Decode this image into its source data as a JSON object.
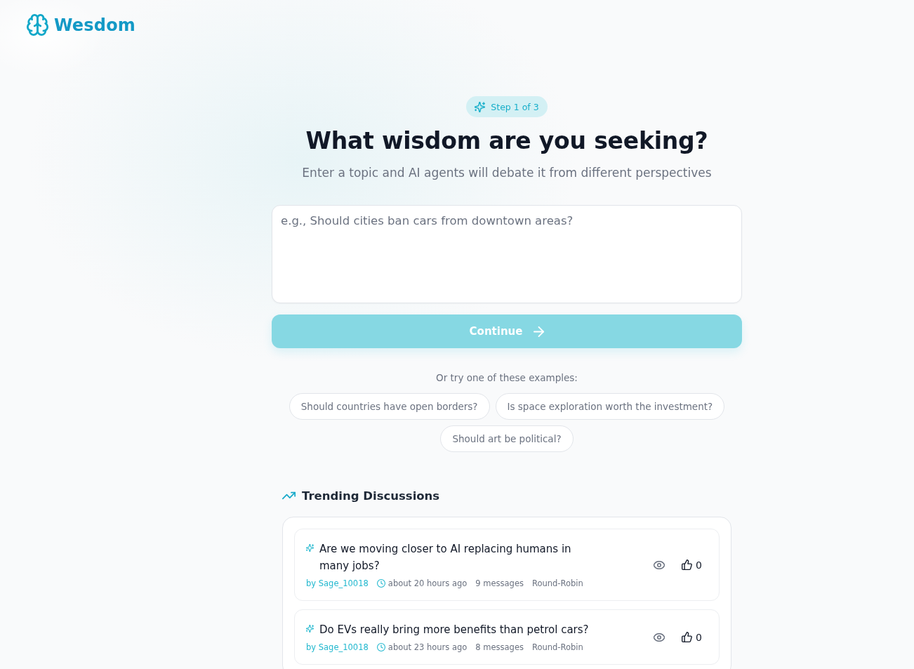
{
  "brand": {
    "name": "Wesdom"
  },
  "step_badge": {
    "label": "Step 1 of 3"
  },
  "heading": "What wisdom are you seeking?",
  "subtitle": "Enter a topic and AI agents will debate it from different perspectives",
  "topic_input": {
    "placeholder": "e.g., Should cities ban cars from downtown areas?"
  },
  "continue_button": {
    "label": "Continue",
    "disabled": true
  },
  "examples": {
    "prompt": "Or try one of these examples:",
    "chips": [
      "Should countries have open borders?",
      "Is space exploration worth the investment?",
      "Should art be political?"
    ]
  },
  "trending": {
    "title": "Trending Discussions",
    "discussions": [
      {
        "title": "Are we moving closer to AI replacing humans in many jobs?",
        "author": "by Sage_10018",
        "time": "about 20 hours ago",
        "messages": "9 messages",
        "mode": "Round-Robin",
        "likes": "0"
      },
      {
        "title": "Do EVs really bring more benefits than petrol cars?",
        "author": "by Sage_10018",
        "time": "about 23 hours ago",
        "messages": "8 messages",
        "mode": "Round-Robin",
        "likes": "0"
      }
    ]
  }
}
